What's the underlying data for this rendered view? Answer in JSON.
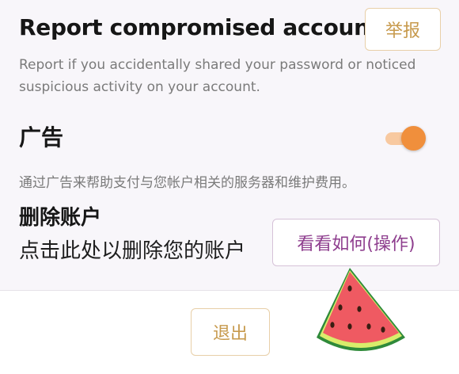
{
  "report": {
    "title": "Report compromised account",
    "button_label": "举报",
    "description": "Report if you accidentally shared your password or noticed suspicious activity on your account."
  },
  "ads": {
    "title": "广告",
    "toggle_on": true,
    "description": "通过广告来帮助支付与您帐户相关的服务器和维护费用。"
  },
  "delete_account": {
    "title": "删除账户",
    "description": "点击此处以删除您的账户",
    "button_label": "看看如何(操作)"
  },
  "footer": {
    "logout_label": "退出"
  },
  "colors": {
    "accent_orange": "#f08f3c",
    "button_gold": "#c79a4d",
    "button_purple": "#8e3e8e"
  },
  "decoration": {
    "sticker_icon": "watermelon-slice-icon"
  }
}
